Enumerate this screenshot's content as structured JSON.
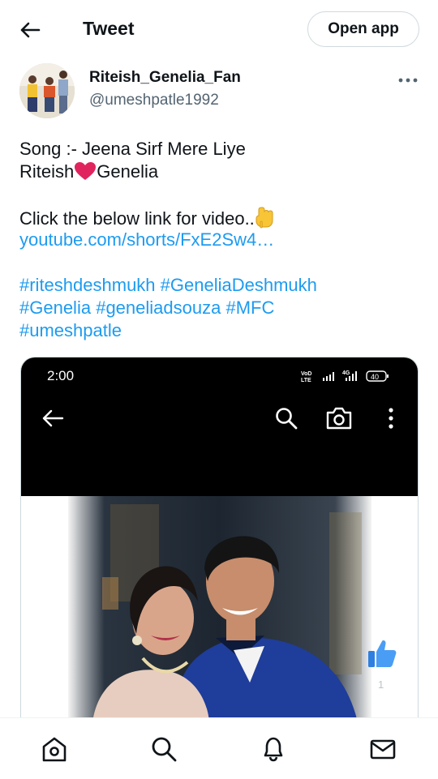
{
  "header": {
    "back_icon": "arrow-left-icon",
    "title": "Tweet",
    "open_app_label": "Open app"
  },
  "author": {
    "display_name": "Riteish_Genelia_Fan",
    "handle": "@umeshpatle1992",
    "more_icon": "more-horizontal-icon"
  },
  "tweet": {
    "line1": "Song :- Jeena Sirf Mere Liye",
    "line2_before": "Riteish",
    "line2_emoji": "red-heart-icon",
    "line2_after": "Genelia",
    "line3": "Click the below link for video..",
    "line3_emoji": "pointing-down-icon",
    "link": "youtube.com/shorts/FxE2Sw4…",
    "hashtags": [
      "#riteshdeshmukh",
      "#GeneliaDeshmukh",
      "#Genelia",
      "#geneliadsouza",
      "#MFC",
      "#umeshpatle"
    ]
  },
  "media": {
    "status_time": "2:00",
    "status_icons": [
      "volte-icon",
      "signal-icon",
      "4g-signal-icon",
      "battery-icon"
    ],
    "battery": "40",
    "volte_label": "VoLTE",
    "network_label": "4G",
    "toolbar_icons": [
      "back-arrow-icon",
      "search-icon",
      "camera-icon",
      "more-vertical-icon"
    ],
    "photo_description_icon": "couple-photo",
    "like_icon": "thumbs-up-icon",
    "like_count": "1"
  },
  "bottom_nav": [
    {
      "icon": "home-icon"
    },
    {
      "icon": "search-icon"
    },
    {
      "icon": "notifications-bell-icon"
    },
    {
      "icon": "messages-envelope-icon"
    }
  ],
  "colors": {
    "link": "#1d9bf0",
    "text": "#0f1419",
    "secondary": "#536471",
    "heart": "#e0245e"
  }
}
